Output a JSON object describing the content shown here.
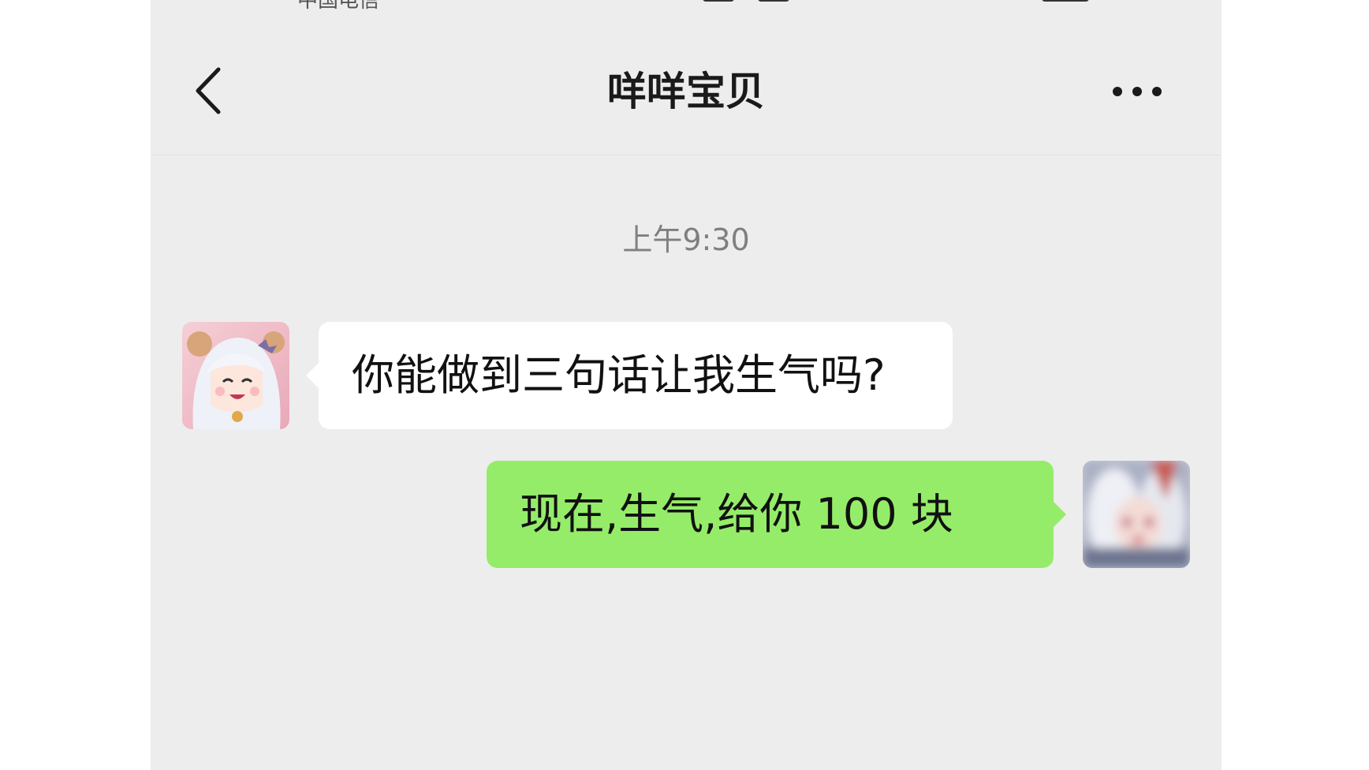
{
  "status_bar": {
    "carrier": "中国电信"
  },
  "header": {
    "title": "咩咩宝贝",
    "back_icon": "chevron-left-icon",
    "more_icon": "more-dots-icon"
  },
  "chat": {
    "timestamp": "上午9:30",
    "messages": [
      {
        "side": "left",
        "text": "你能做到三句话让我生气吗?",
        "bubble_color": "#ffffff",
        "avatar": "anime-girl-avatar"
      },
      {
        "side": "right",
        "text": "现在,生气,给你 100 块",
        "bubble_color": "#95ec69",
        "avatar": "blurred-avatar"
      }
    ]
  },
  "colors": {
    "background": "#ededed",
    "outgoing_bubble": "#95ec69",
    "incoming_bubble": "#ffffff"
  }
}
